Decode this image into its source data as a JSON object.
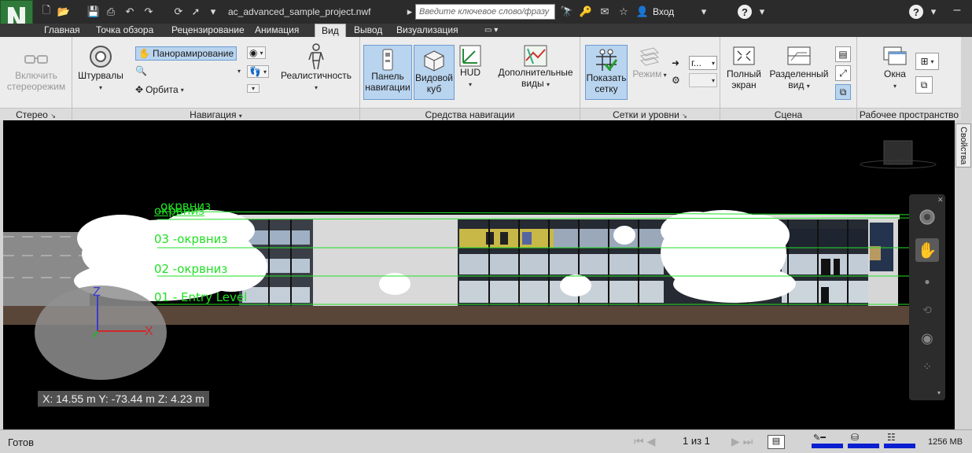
{
  "titlebar": {
    "filename": "ac_advanced_sample_project.nwf",
    "search_placeholder": "Введите ключевое слово/фразу",
    "login": "Вход"
  },
  "tabs": [
    {
      "label": "Главная"
    },
    {
      "label": "Точка обзора"
    },
    {
      "label": "Рецензирование"
    },
    {
      "label": "Анимация"
    },
    {
      "label": "Вид",
      "active": true
    },
    {
      "label": "Вывод"
    },
    {
      "label": "Визуализация"
    }
  ],
  "ribbon": {
    "stereo": {
      "title": "Стерео",
      "enable_label": "Включить стереорежим"
    },
    "navigation": {
      "title": "Навигация",
      "wheels": "Штурвалы",
      "pan": "Панорамирование",
      "orbit": "Орбита",
      "realism": "Реалистичность"
    },
    "nav_tools": {
      "title": "Средства навигации",
      "nav_bar": "Панель навигации",
      "view_cube": "Видовой куб",
      "hud": "HUD",
      "extra_views": "Дополнительные виды"
    },
    "grids": {
      "title": "Сетки и уровни",
      "show_grid": "Показать сетку",
      "mode": "Режим",
      "level_select": "г..."
    },
    "scene": {
      "title": "Сцена",
      "fullscreen": "Полный экран",
      "split_view": "Разделенный вид"
    },
    "workspace": {
      "title": "Рабочее пространство",
      "windows": "Окна"
    }
  },
  "properties_tab": "Свойства",
  "viewport": {
    "levels": [
      {
        "label": "окрвниз"
      },
      {
        "label": "окрвниз"
      },
      {
        "label": "03 -окрвниз"
      },
      {
        "label": "02 -окрвниз"
      },
      {
        "label": "01 - Entry Level"
      }
    ],
    "coords": "X: 14.55 m  Y: -73.44 m  Z: 4.23 m",
    "axes": {
      "x": "X",
      "z": "Z"
    }
  },
  "status": {
    "text": "Готов",
    "pages": "1 из 1",
    "memory": "1256 MB"
  },
  "colors": {
    "grid_line": "#22e026",
    "selected": "#b9d4ee",
    "titlebar": "#2b2b2b"
  }
}
